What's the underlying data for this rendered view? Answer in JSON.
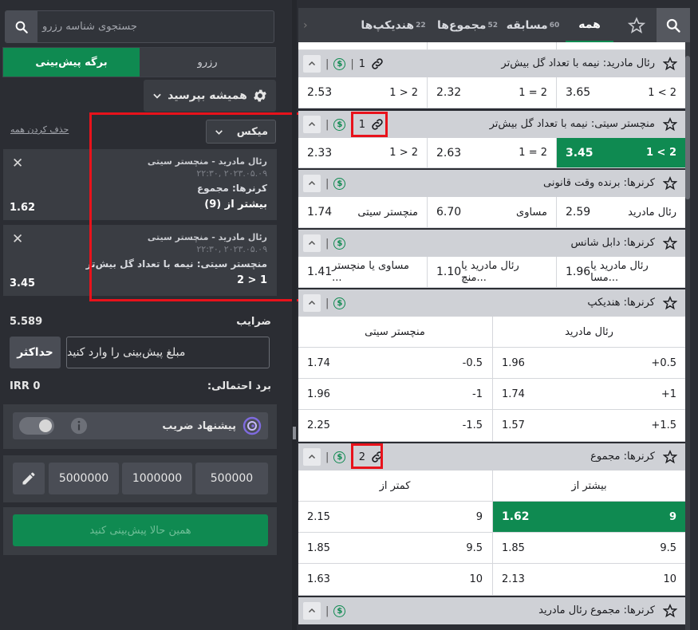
{
  "slip": {
    "search_placeholder": "جستجوی شناسه رزرو",
    "tab_betslip": "برگه پیش‌بینی",
    "tab_reserve": "رزرو",
    "odds_change_label": "همیشه بپرسید",
    "clear_all": "حذف کردن همه",
    "mode_label": "میکس",
    "bets": [
      {
        "match": "رئال مادرید - منچستر سیتی",
        "date": "۲۰۲۳.۰۵.۰۹ ,۲۲:۳۰",
        "market": "کرنرها: مجموع",
        "selection": "بیشتر از (9)",
        "odds": "1.62"
      },
      {
        "match": "رئال مادرید - منچستر سیتی",
        "date": "۲۰۲۳.۰۵.۰۹ ,۲۲:۳۰",
        "market": "منچستر سیتی: نیمه با تعداد گل بیش‌تر",
        "selection": "1 < 2",
        "odds": "3.45"
      }
    ],
    "total_odds_label": "ضرایب",
    "total_odds": "5.589",
    "max_button": "حداکثر",
    "amount_placeholder": "مبلغ پیش‌بینی را وارد کنید",
    "potential_win_label": "برد احتمالی:",
    "potential_win": "IRR 0",
    "suggest_label": "پیشنهاد ضریب",
    "quick_stakes": [
      "500000",
      "1000000",
      "5000000"
    ],
    "place_button": "همین حالا پیش‌بینی کنید"
  },
  "market_tabs": [
    {
      "label": "همه",
      "count": ""
    },
    {
      "label": "مسابقه",
      "count": "60"
    },
    {
      "label": "مجموع‌ها",
      "count": "52"
    },
    {
      "label": "هندیکپ‌ها",
      "count": "22"
    }
  ],
  "markets": {
    "m1": {
      "title": "رئال مادرید: نیمه با تعداد گل بیش‌تر",
      "link_count": "1",
      "odds": [
        {
          "label": "1 < 2",
          "odds": "3.65"
        },
        {
          "label": "1 = 2",
          "odds": "2.32"
        },
        {
          "label": "1 > 2",
          "odds": "2.53"
        }
      ]
    },
    "m2": {
      "title": "منچستر سیتی: نیمه با تعداد گل بیش‌تر",
      "link_count": "1",
      "odds": [
        {
          "label": "1 < 2",
          "odds": "3.45"
        },
        {
          "label": "1 = 2",
          "odds": "2.63"
        },
        {
          "label": "1 > 2",
          "odds": "2.33"
        }
      ]
    },
    "m3": {
      "title": "کرنرها: برنده وقت قانونی",
      "odds": [
        {
          "label": "رئال مادرید",
          "odds": "2.59"
        },
        {
          "label": "مساوی",
          "odds": "6.70"
        },
        {
          "label": "منچستر سیتی",
          "odds": "1.74"
        }
      ]
    },
    "m4": {
      "title": "کرنرها: دابل شانس",
      "odds": [
        {
          "label": "رئال مادرید یا مسا...",
          "odds": "1.96"
        },
        {
          "label": "رئال مادرید یا منچ...",
          "odds": "1.10"
        },
        {
          "label": "مساوی یا منچستر ...",
          "odds": "1.41"
        }
      ]
    },
    "m5": {
      "title": "کرنرها: هندیکپ",
      "col_right": "رئال مادرید",
      "col_left": "منچستر سیتی",
      "rows": [
        {
          "rh": "+0.5",
          "ro": "1.96",
          "lh": "-0.5",
          "lo": "1.74"
        },
        {
          "rh": "+1",
          "ro": "1.74",
          "lh": "-1",
          "lo": "1.96"
        },
        {
          "rh": "+1.5",
          "ro": "1.57",
          "lh": "-1.5",
          "lo": "2.25"
        }
      ]
    },
    "m6": {
      "title": "کرنرها: مجموع",
      "link_count": "2",
      "col_right": "بیشتر از",
      "col_left": "کمتر از",
      "rows": [
        {
          "rh": "9",
          "ro": "1.62",
          "lh": "9",
          "lo": "2.15"
        },
        {
          "rh": "9.5",
          "ro": "1.85",
          "lh": "9.5",
          "lo": "1.85"
        },
        {
          "rh": "10",
          "ro": "2.13",
          "lh": "10",
          "lo": "1.63"
        }
      ]
    },
    "m7": {
      "title": "کرنرها: مجموع رئال مادرید"
    }
  },
  "colors": {
    "accent": "#0f8a51",
    "highlight": "#e8121b"
  }
}
